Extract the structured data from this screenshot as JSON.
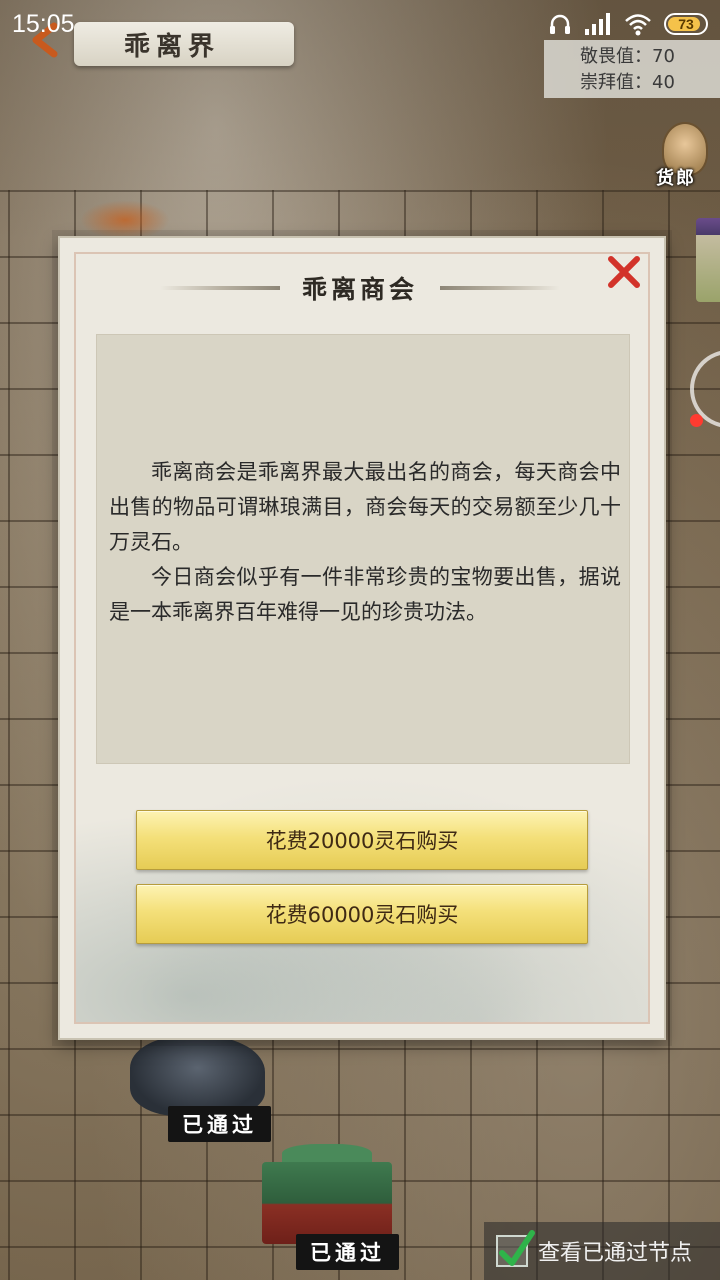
{
  "status_bar": {
    "time": "15:05",
    "battery_level": "73",
    "icons": [
      "headphones-icon",
      "signal-icon",
      "wifi-icon",
      "battery-icon"
    ]
  },
  "area": {
    "name": "乖离界",
    "back_icon": "back-arrow-icon"
  },
  "stats": {
    "awe": "敬畏值：70",
    "worship": "崇拜值：40"
  },
  "merchant": {
    "label": "货郎"
  },
  "dialog": {
    "title": "乖离商会",
    "close_icon": "close-icon",
    "paragraphs": [
      "乖离商会是乖离界最大最出名的商会，每天商会中出售的物品可谓琳琅满目，商会每天的交易额至少几十万灵石。",
      "今日商会似乎有一件非常珍贵的宝物要出售，据说是一本乖离界百年难得一见的珍贵功法。"
    ],
    "buttons": [
      {
        "label": "花费20000灵石购买"
      },
      {
        "label": "花费60000灵石购买"
      }
    ]
  },
  "map_nodes": {
    "passed_label_1": "已通过",
    "passed_label_2": "已通过"
  },
  "footer": {
    "view_passed_label": "查看已通过节点",
    "view_passed_checked": true
  },
  "colors": {
    "button_gold": "#f4e07a",
    "close_red": "#d2332a",
    "check_green": "#2fb34a"
  }
}
